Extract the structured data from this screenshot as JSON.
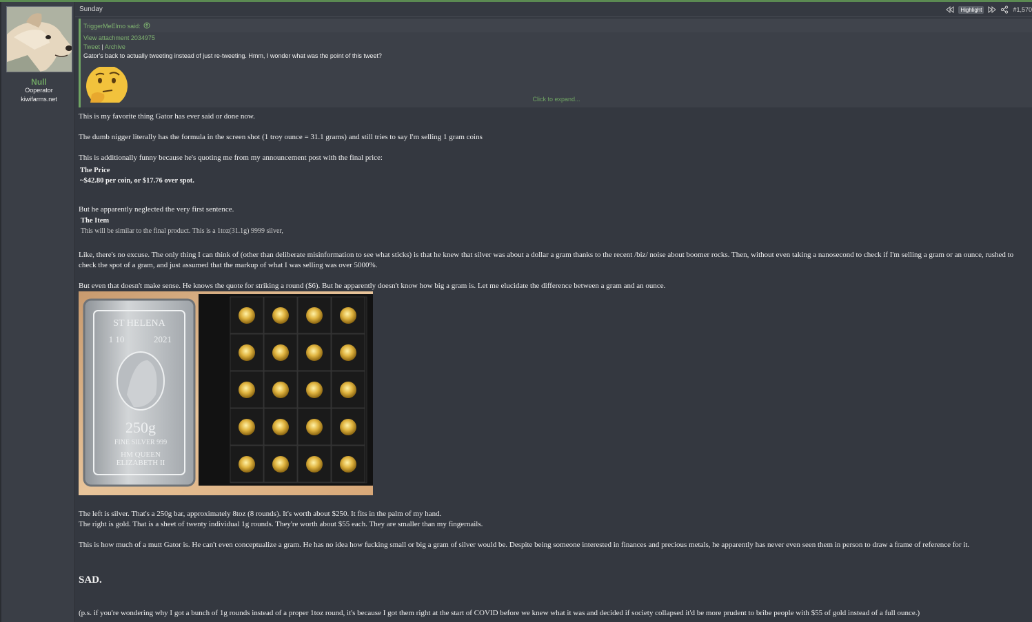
{
  "post": {
    "date": "Sunday",
    "highlight_label": "Highlight",
    "post_number": "#1,570"
  },
  "author": {
    "name": "Null",
    "title": "Ooperator",
    "site": "kiwifarms.net"
  },
  "quote": {
    "author": "TriggerMeElmo said:",
    "attachment_link": "View attachment 2034975",
    "tweet_link": "Tweet",
    "separator": "|",
    "archive_link": "Archive",
    "text": "Gator's back to actually tweeting instead of just re-tweeting. Hmm, I wonder what was the point of this tweet?",
    "expand_label": "Click to expand..."
  },
  "body": {
    "p1": "This is my favorite thing Gator has ever said or done now.",
    "p2": "The dumb nigger literally has the formula in the screen shot (1 troy ounce = 31.1 grams) and still tries to say I'm selling 1 gram coins",
    "p3": "This is additionally funny because he's quoting me from my announcement post with the final price:",
    "price_title": "The Price",
    "price_text": "~$42.80 per coin, or $17.76 over spot.",
    "p4": "But he apparently neglected the very first sentence.",
    "item_title": "The Item",
    "item_text": "This will be similar to the final product. This is a 1toz(31.1g) 9999 silver,",
    "p5": "Like, there's no excuse. The only thing I can think of (other than deliberate misinformation to see what sticks) is that he knew that silver was about a dollar a gram thanks to the recent /biz/ noise about boomer rocks. Then, without even taking a nanosecond to check if I'm selling a gram or an ounce, rushed to check the spot of a gram, and just assumed that the markup of what I was selling was over 5000%.",
    "p6": "But even that doesn't make sense. He knows the quote for striking a round ($6). But he apparently doesn't know how big a gram is. Let me elucidate the difference between a gram and an ounce.",
    "p7a": "The left is silver. That's a 250g bar, approximately 8toz (8 rounds). It's worth about $250. It fits in the palm of my hand.",
    "p7b": "The right is gold. That is a sheet of twenty individual 1g rounds. They're worth about $55 each. They are smaller than my fingernails.",
    "p8": "This is how much of a mutt Gator is. He can't even conceptualize a gram. He has no idea how fucking small or big a gram of silver would be. Despite being someone interested in finances and precious metals, he apparently has never even seen them in person to draw a frame of reference for it.",
    "sad": "SAD.",
    "p9": "(p.s. if you're wondering why I got a bunch of 1g rounds instead of a proper 1toz round, it's because I got them right at the start of COVID before we knew what it was and decided if society collapsed it'd be more prudent to bribe people with $55 of gold instead of a full ounce.)"
  },
  "photo": {
    "bar_line1": "ST HELENA",
    "bar_year_left": "1 10",
    "bar_year_right": "2021",
    "bar_weight": "250g",
    "bar_fine": "FINE SILVER 999",
    "bar_line2": "HM QUEEN",
    "bar_line3": "ELIZABETH II"
  },
  "colors": {
    "accent_green": "#6fa463",
    "background": "#343840"
  }
}
